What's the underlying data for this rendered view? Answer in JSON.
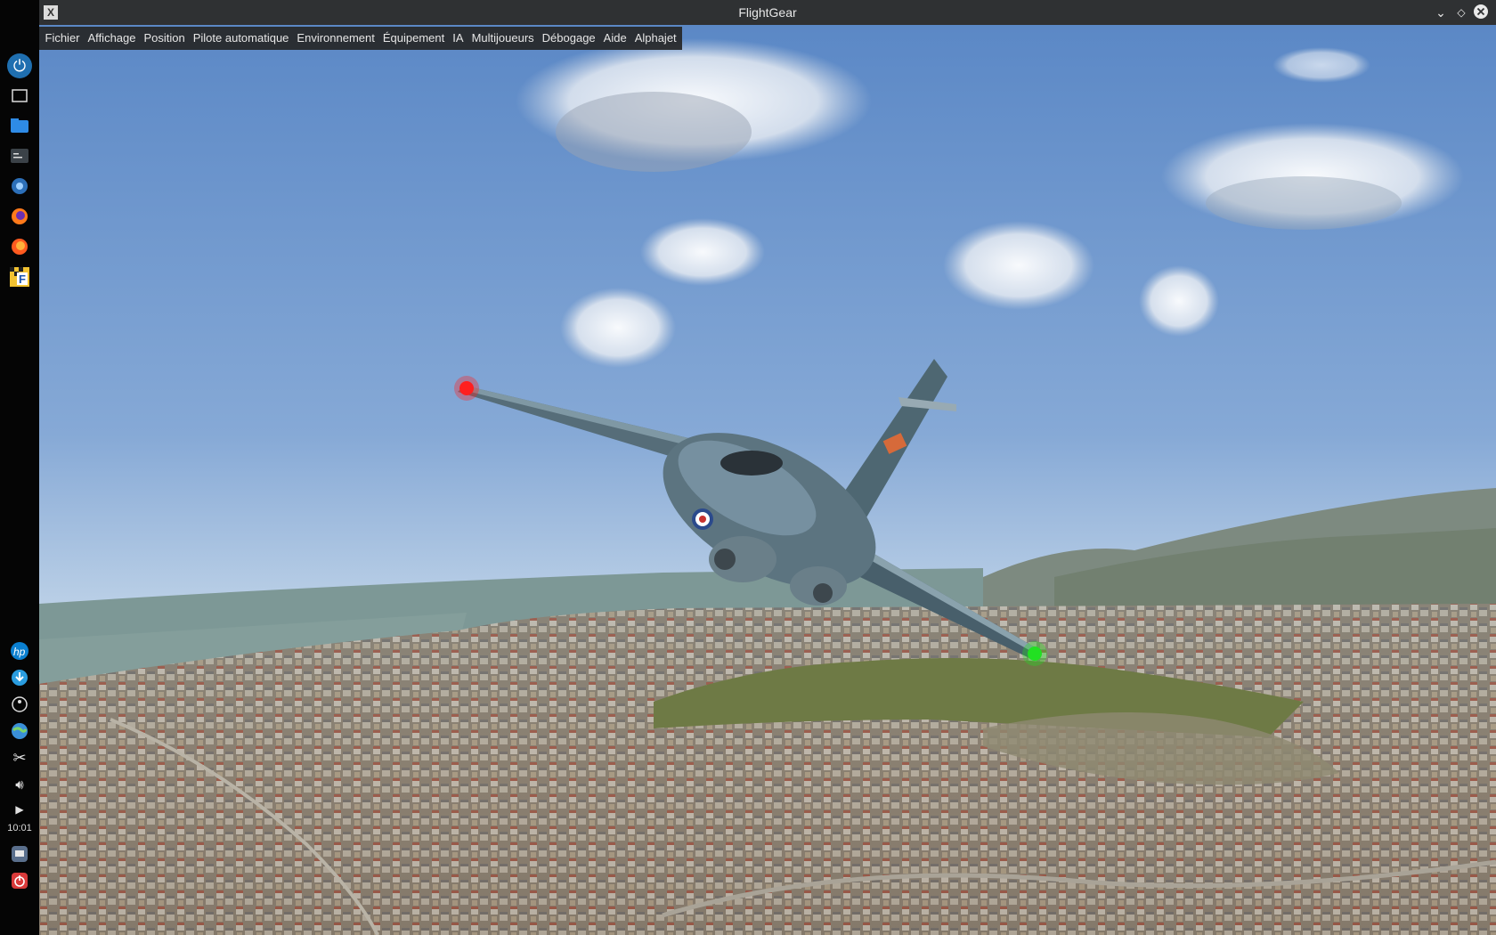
{
  "window": {
    "title": "FlightGear"
  },
  "menubar": {
    "items": [
      {
        "label": "Fichier"
      },
      {
        "label": "Affichage"
      },
      {
        "label": "Position"
      },
      {
        "label": "Pilote automatique"
      },
      {
        "label": "Environnement"
      },
      {
        "label": "Équipement"
      },
      {
        "label": "IA"
      },
      {
        "label": "Multijoueurs"
      },
      {
        "label": "Débogage"
      },
      {
        "label": "Aide"
      },
      {
        "label": "Alphajet"
      }
    ]
  },
  "taskbar": {
    "clock": "10:01",
    "icons": [
      "kde-launcher-icon",
      "desktop-icon",
      "file-manager-icon",
      "terminal-icon",
      "system-settings-icon",
      "firefox-icon",
      "firefox-dev-icon",
      "flightgear-icon",
      "hp-icon",
      "download-icon",
      "accessibility-icon",
      "network-globe-icon",
      "scissors-icon",
      "volume-icon",
      "expand-arrow-icon",
      "printer-icon",
      "power-icon"
    ]
  },
  "colors": {
    "sky_top": "#5f8cc8",
    "sky_horizon": "#c7d9ea",
    "sea": "#7e9a97",
    "city": "#8b8070",
    "aircraft": "#4f6570",
    "titlebar": "#2f3133",
    "taskbar": "#050505"
  }
}
